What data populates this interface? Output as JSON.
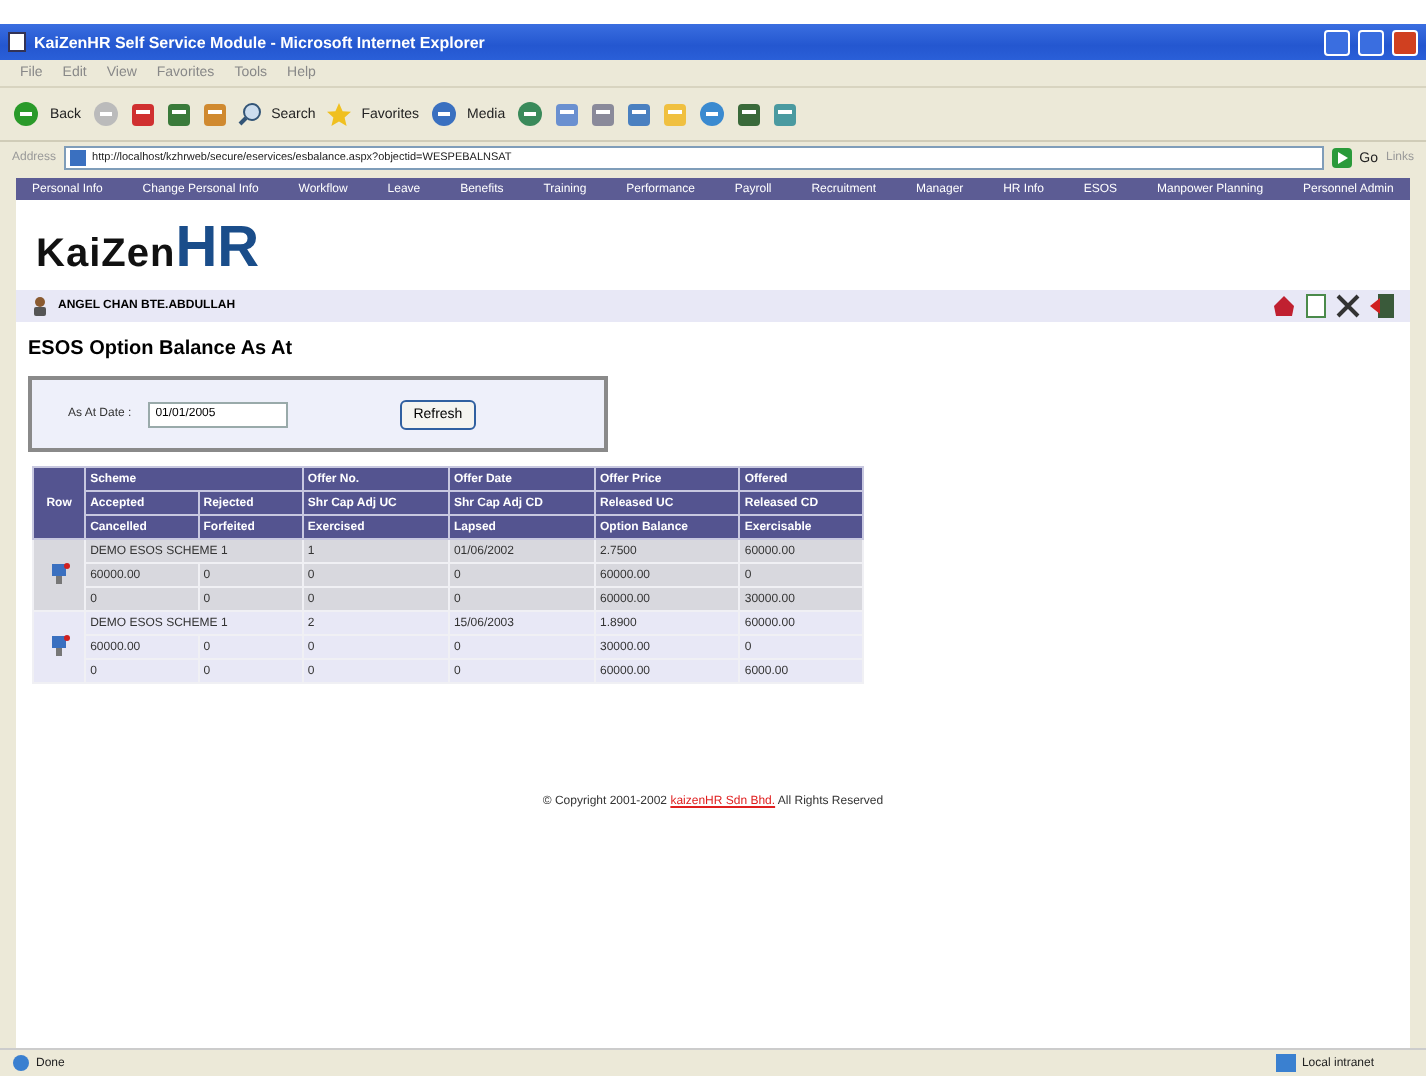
{
  "window": {
    "title": "KaiZenHR Self Service Module - Microsoft Internet Explorer"
  },
  "menu": [
    "File",
    "Edit",
    "View",
    "Favorites",
    "Tools",
    "Help"
  ],
  "toolbar": [
    "Back",
    "Search",
    "Favorites",
    "Media"
  ],
  "address": {
    "label": "Address",
    "url": "http://localhost/kzhrweb/secure/eservices/esbalance.aspx?objectid=WESPEBALNSAT",
    "go": "Go",
    "links": "Links"
  },
  "nav": [
    "Personal Info",
    "Change Personal Info",
    "Workflow",
    "Leave",
    "Benefits",
    "Training",
    "Performance",
    "Payroll",
    "Recruitment",
    "Manager",
    "HR Info",
    "ESOS",
    "Manpower Planning",
    "Personnel Admin"
  ],
  "logo": {
    "part_1": "KaiZen",
    "part_2": "HR"
  },
  "user": "ANGEL CHAN BTE.ABDULLAH",
  "page_title": "ESOS Option Balance As At",
  "form": {
    "label": "As At Date :",
    "date": "01/01/2005",
    "button": "Refresh"
  },
  "table": {
    "row_header": "Row",
    "header_rows": [
      [
        "Scheme",
        "Offer No.",
        "Offer Date",
        "Offer Price",
        "Offered"
      ],
      [
        "Accepted",
        "Rejected",
        "Shr Cap Adj UC",
        "Shr Cap Adj CD",
        "Released UC",
        "Released CD"
      ],
      [
        "Cancelled",
        "Forfeited",
        "Exercised",
        "Lapsed",
        "Option Balance",
        "Exercisable"
      ]
    ],
    "groups": [
      {
        "first": [
          "DEMO ESOS SCHEME 1",
          "1",
          "01/06/2002",
          "2.7500",
          "60000.00"
        ],
        "lines": [
          [
            "60000.00",
            "0",
            "0",
            "0",
            "60000.00",
            "0"
          ],
          [
            "0",
            "0",
            "0",
            "0",
            "60000.00",
            "30000.00"
          ]
        ]
      },
      {
        "first": [
          "DEMO ESOS SCHEME 1",
          "2",
          "15/06/2003",
          "1.8900",
          "60000.00"
        ],
        "lines": [
          [
            "60000.00",
            "0",
            "0",
            "0",
            "30000.00",
            "0"
          ],
          [
            "0",
            "0",
            "0",
            "0",
            "60000.00",
            "6000.00"
          ]
        ]
      }
    ]
  },
  "footer": {
    "before": "© Copyright 2001-2002 ",
    "link": "kaizenHR Sdn Bhd.",
    "after": " All Rights Reserved"
  },
  "status": {
    "text": "Done",
    "zone": "Local intranet"
  }
}
